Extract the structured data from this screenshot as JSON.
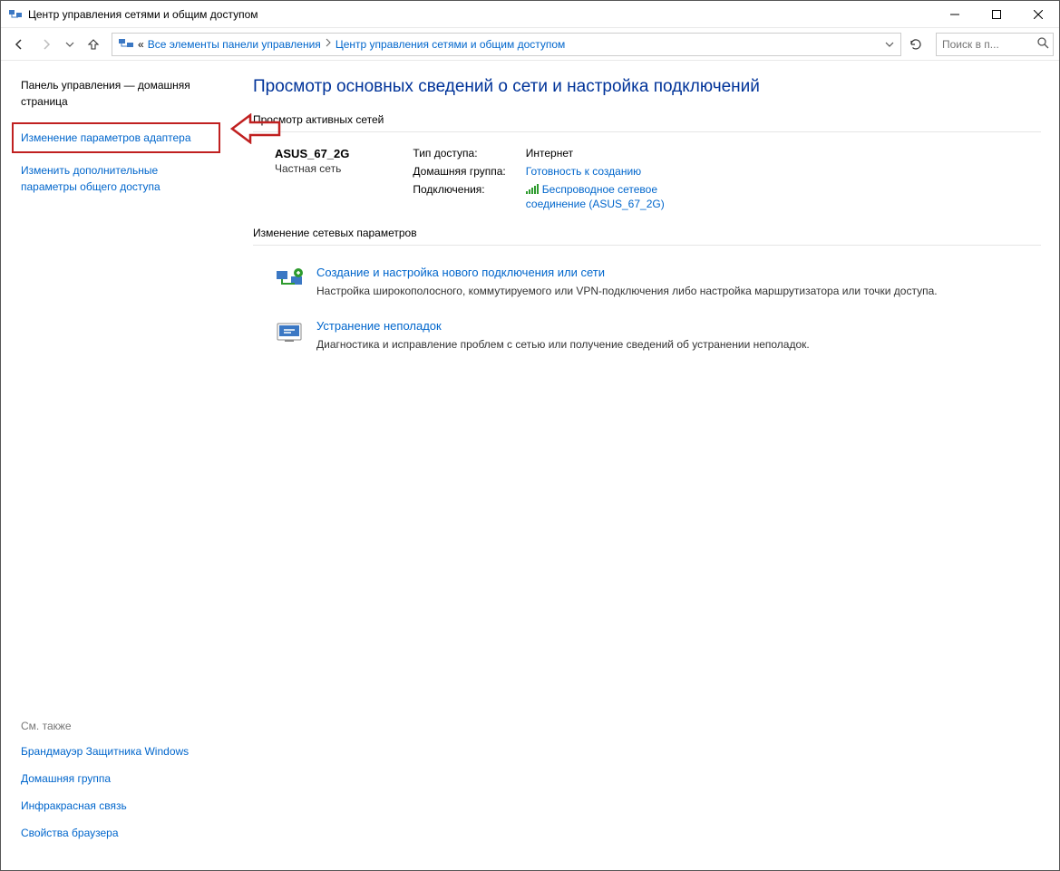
{
  "window": {
    "title": "Центр управления сетями и общим доступом"
  },
  "breadcrumb": {
    "prefix": "«",
    "item1": "Все элементы панели управления",
    "item2": "Центр управления сетями и общим доступом"
  },
  "search": {
    "placeholder": "Поиск в п..."
  },
  "sidebar": {
    "home": "Панель управления — домашняя страница",
    "adapter": "Изменение параметров адаптера",
    "sharing": "Изменить дополнительные параметры общего доступа",
    "see_also_label": "См. также",
    "see_also": {
      "firewall": "Брандмауэр Защитника Windows",
      "homegroup": "Домашняя группа",
      "infrared": "Инфракрасная связь",
      "inetopts": "Свойства браузера"
    }
  },
  "main": {
    "heading": "Просмотр основных сведений о сети и настройка подключений",
    "active_title": "Просмотр активных сетей",
    "network": {
      "name": "ASUS_67_2G",
      "type": "Частная сеть",
      "access_label": "Тип доступа:",
      "access_value": "Интернет",
      "homegroup_label": "Домашняя группа:",
      "homegroup_value": "Готовность к созданию",
      "conn_label": "Подключения:",
      "conn_value": "Беспроводное сетевое соединение (ASUS_67_2G)"
    },
    "change_title": "Изменение сетевых параметров",
    "task1": {
      "title": "Создание и настройка нового подключения или сети",
      "desc": "Настройка широкополосного, коммутируемого или VPN-подключения либо настройка маршрутизатора или точки доступа."
    },
    "task2": {
      "title": "Устранение неполадок",
      "desc": "Диагностика и исправление проблем с сетью или получение сведений об устранении неполадок."
    }
  }
}
